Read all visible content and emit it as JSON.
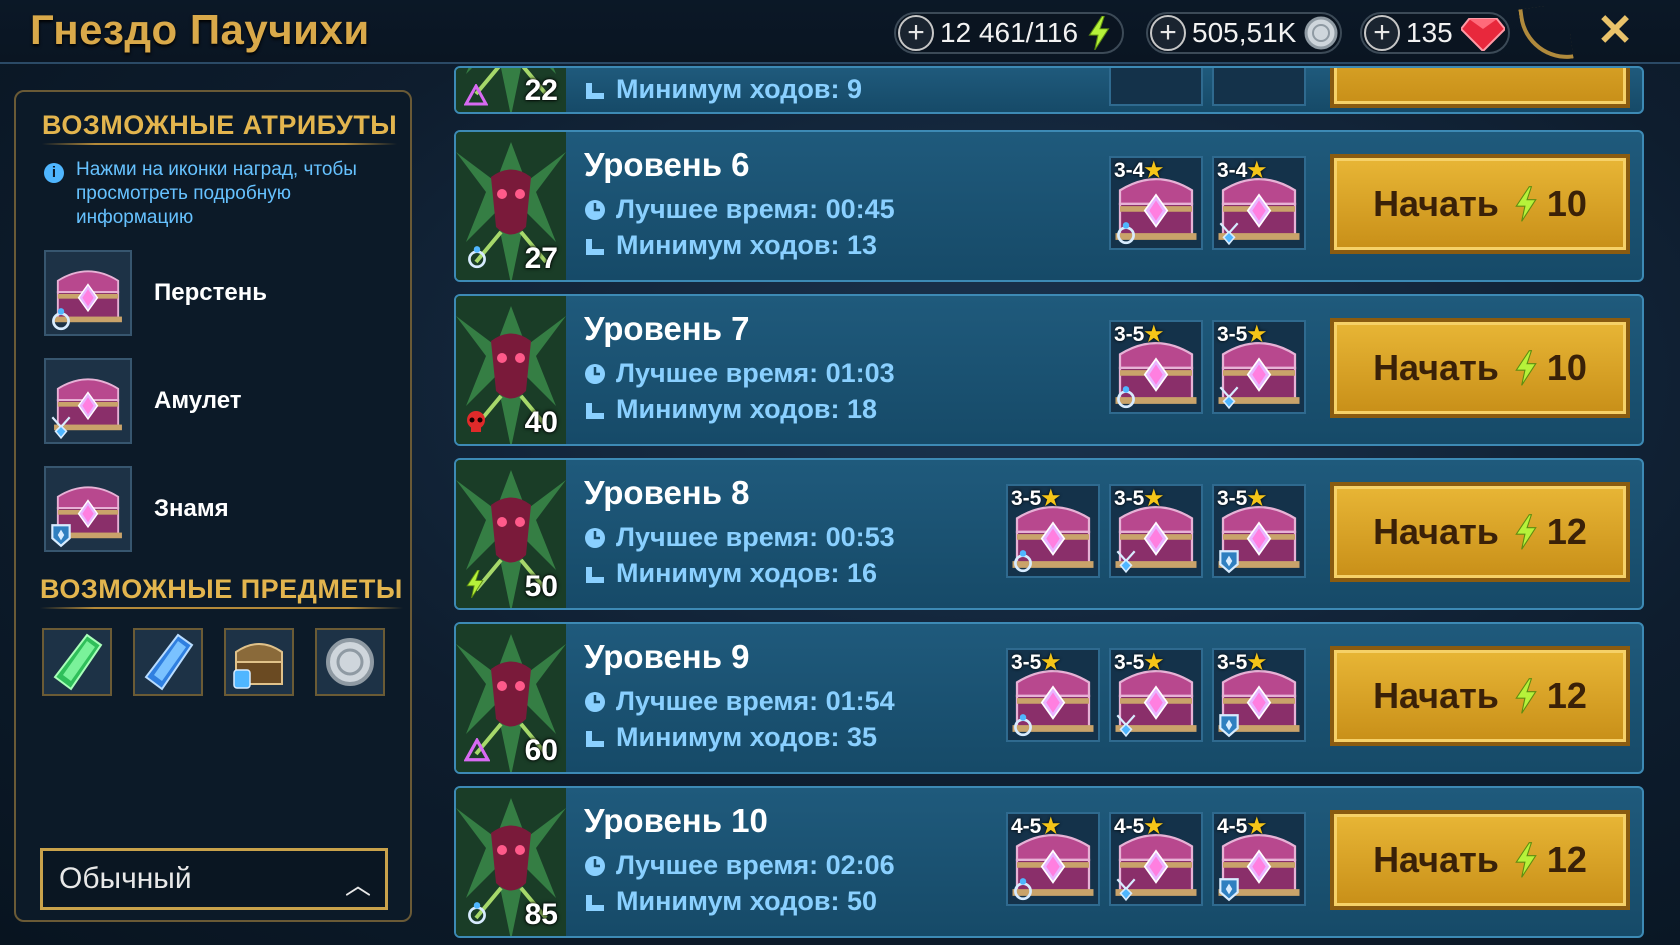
{
  "header": {
    "title": "Гнездо Паучихи",
    "energy": "12 461/116",
    "silver": "505,51K",
    "gems": "135",
    "close_label": "✕"
  },
  "sidebar": {
    "attributes_title": "ВОЗМОЖНЫЕ АТРИБУТЫ",
    "info_text": "Нажми на иконки наград, чтобы просмотреть подробную информацию",
    "attributes": [
      {
        "name": "Перстень",
        "slot": "ring-icon"
      },
      {
        "name": "Амулет",
        "slot": "amulet-icon"
      },
      {
        "name": "Знамя",
        "slot": "banner-icon"
      }
    ],
    "items_title": "ВОЗМОЖНЫЕ ПРЕДМЕТЫ",
    "items": [
      "green-shard-icon",
      "blue-shard-icon",
      "chest-potion-icon",
      "silver-coin-icon"
    ],
    "difficulty": "Обычный"
  },
  "levels": {
    "partial": {
      "boss_level": "22",
      "min_turns": "Минимум ходов: 9"
    },
    "rows": [
      {
        "title": "Уровень 6",
        "boss_level": "27",
        "best_time": "Лучшее время: 00:45",
        "min_turns": "Минимум ходов: 13",
        "start_label": "Начать",
        "cost": "10",
        "rewards": [
          {
            "stars": "3-4",
            "slot": "ring-icon"
          },
          {
            "stars": "3-4",
            "slot": "amulet-icon"
          }
        ]
      },
      {
        "title": "Уровень 7",
        "boss_level": "40",
        "best_time": "Лучшее время: 01:03",
        "min_turns": "Минимум ходов: 18",
        "start_label": "Начать",
        "cost": "10",
        "rewards": [
          {
            "stars": "3-5",
            "slot": "ring-icon"
          },
          {
            "stars": "3-5",
            "slot": "amulet-icon"
          }
        ]
      },
      {
        "title": "Уровень 8",
        "boss_level": "50",
        "best_time": "Лучшее время: 00:53",
        "min_turns": "Минимум ходов: 16",
        "start_label": "Начать",
        "cost": "12",
        "rewards": [
          {
            "stars": "3-5",
            "slot": "ring-icon"
          },
          {
            "stars": "3-5",
            "slot": "amulet-icon"
          },
          {
            "stars": "3-5",
            "slot": "banner-icon"
          }
        ]
      },
      {
        "title": "Уровень 9",
        "boss_level": "60",
        "best_time": "Лучшее время: 01:54",
        "min_turns": "Минимум ходов: 35",
        "start_label": "Начать",
        "cost": "12",
        "rewards": [
          {
            "stars": "3-5",
            "slot": "ring-icon"
          },
          {
            "stars": "3-5",
            "slot": "amulet-icon"
          },
          {
            "stars": "3-5",
            "slot": "banner-icon"
          }
        ]
      },
      {
        "title": "Уровень 10",
        "boss_level": "85",
        "best_time": "Лучшее время: 02:06",
        "min_turns": "Минимум ходов: 50",
        "start_label": "Начать",
        "cost": "12",
        "rewards": [
          {
            "stars": "4-5",
            "slot": "ring-icon"
          },
          {
            "stars": "4-5",
            "slot": "amulet-icon"
          },
          {
            "stars": "4-5",
            "slot": "banner-icon"
          }
        ]
      }
    ]
  },
  "colors": {
    "accent_gold": "#e3b54e",
    "stat_blue": "#8ad0ff",
    "button_gold": "#e8b636",
    "row_bg": "#1f5a7c"
  }
}
